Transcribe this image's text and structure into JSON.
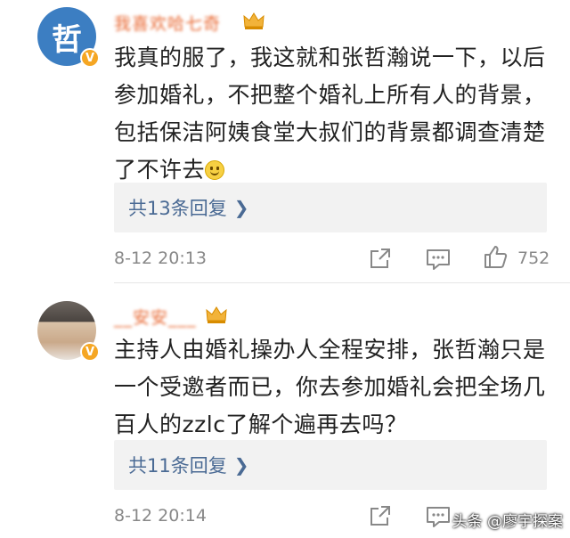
{
  "comments": [
    {
      "username": "我喜欢哈七奇",
      "avatar_glyph": "哲",
      "text": "我真的服了，我这就和张哲瀚说一下，以后\n参加婚礼，不把整个婚礼上所有人的背景，\n包括保洁阿姨食堂大叔们的背景都调查清楚\n了不许去",
      "has_emoji": true,
      "replies_label": "共13条回复",
      "time": "8-12 20:13",
      "likes": "752"
    },
    {
      "username": "__安安___",
      "avatar_glyph": "",
      "text": "主持人由婚礼操办人全程安排，张哲瀚只是\n一个受邀者而已，你去参加婚礼会把全场几\n百人的zzlc了解个遍再去吗？",
      "has_emoji": false,
      "replies_label": "共11条回复",
      "time": "8-12 20:14",
      "likes": ""
    }
  ],
  "watermark": "头条 @廖宇探案",
  "colors": {
    "username": "#e8662f",
    "link": "#4a6a94",
    "meta": "#888888",
    "badge": "#f5a623"
  },
  "icons": [
    "v-verified-badge-icon",
    "crown-vip-icon",
    "share-icon",
    "comment-icon",
    "like-icon",
    "chevron-right-icon",
    "smile-emoji-icon"
  ]
}
